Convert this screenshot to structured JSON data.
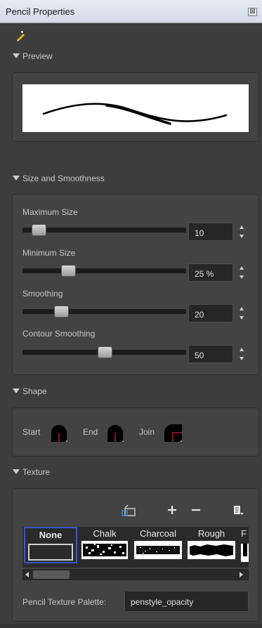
{
  "window": {
    "title": "Pencil Properties",
    "close_glyph": "⊠"
  },
  "sections": {
    "preview": {
      "label": "Preview"
    },
    "size": {
      "label": "Size and Smoothness"
    },
    "shape": {
      "label": "Shape"
    },
    "texture": {
      "label": "Texture"
    }
  },
  "sliders": [
    {
      "label": "Maximum Size",
      "value_text": "10",
      "position_pct": 7
    },
    {
      "label": "Minimum Size",
      "value_text": "25 %",
      "position_pct": 25
    },
    {
      "label": "Smoothing",
      "value_text": "20",
      "position_pct": 20
    },
    {
      "label": "Contour Smoothing",
      "value_text": "50",
      "position_pct": 50
    }
  ],
  "shape": {
    "start_label": "Start",
    "end_label": "End",
    "join_label": "Join"
  },
  "texture": {
    "tiles": [
      {
        "name": "None",
        "selected": true
      },
      {
        "name": "Chalk",
        "selected": false
      },
      {
        "name": "Charcoal",
        "selected": false
      },
      {
        "name": "Rough",
        "selected": false
      },
      {
        "name": "F",
        "selected": false
      }
    ],
    "palette_label": "Pencil Texture Palette:",
    "palette_value": "penstyle_opacity"
  },
  "colors": {
    "panel_bg": "#3d3d3d",
    "selection_border": "#3b58c8",
    "cap_red": "#d62020"
  },
  "icons": {
    "tool": "pencil-add-icon",
    "import": "import-texture-icon",
    "add": "plus-icon",
    "remove": "minus-icon",
    "menu": "menu-icon"
  }
}
